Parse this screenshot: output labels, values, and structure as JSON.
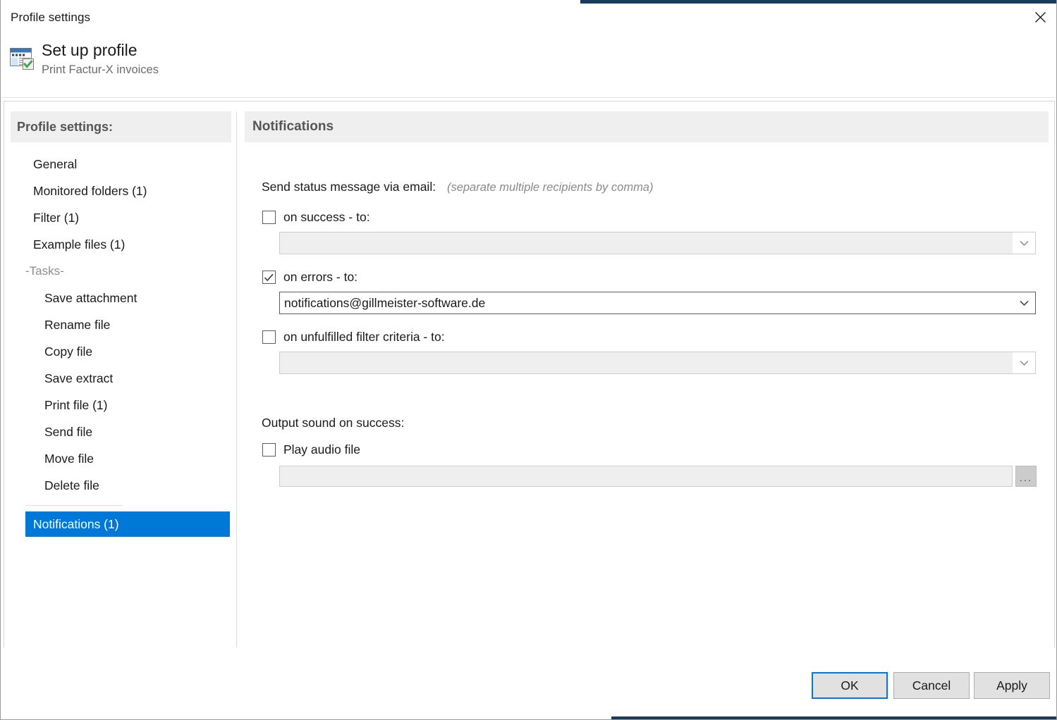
{
  "window": {
    "title": "Profile settings",
    "close_icon": "close-icon"
  },
  "header": {
    "icon": "profile-window-check-icon",
    "title": "Set up profile",
    "subtitle": "Print Factur-X invoices"
  },
  "sidebar": {
    "header": "Profile settings:",
    "items": [
      {
        "label": "General",
        "level": 1,
        "selected": false
      },
      {
        "label": "Monitored folders (1)",
        "level": 1,
        "selected": false
      },
      {
        "label": "Filter (1)",
        "level": 1,
        "selected": false
      },
      {
        "label": "Example files (1)",
        "level": 1,
        "selected": false
      },
      {
        "label": "-Tasks-",
        "level": 0,
        "selected": false,
        "group": true
      },
      {
        "label": "Save attachment",
        "level": 2,
        "selected": false
      },
      {
        "label": "Rename file",
        "level": 2,
        "selected": false
      },
      {
        "label": "Copy file",
        "level": 2,
        "selected": false
      },
      {
        "label": "Save extract",
        "level": 2,
        "selected": false
      },
      {
        "label": "Print file (1)",
        "level": 2,
        "selected": false
      },
      {
        "label": "Send file",
        "level": 2,
        "selected": false
      },
      {
        "label": "Move file",
        "level": 2,
        "selected": false
      },
      {
        "label": "Delete file",
        "level": 2,
        "selected": false
      },
      {
        "separator": true
      },
      {
        "label": "Notifications (1)",
        "level": 1,
        "selected": true
      }
    ]
  },
  "content": {
    "header": "Notifications",
    "email_section": {
      "label": "Send status message via email:",
      "hint": "(separate multiple recipients by comma)",
      "rows": [
        {
          "checkbox_label": "on success - to:",
          "checked": false,
          "value": "",
          "enabled": false,
          "dropdown_icon": "chevron-down-icon"
        },
        {
          "checkbox_label": "on errors - to:",
          "checked": true,
          "value": "notifications@gillmeister-software.de",
          "enabled": true,
          "dropdown_icon": "chevron-down-icon"
        },
        {
          "checkbox_label": "on unfulfilled filter criteria - to:",
          "checked": false,
          "value": "",
          "enabled": false,
          "dropdown_icon": "chevron-down-icon"
        }
      ]
    },
    "sound_section": {
      "label": "Output sound on success:",
      "checkbox_label": "Play audio file",
      "checked": false,
      "path_value": "",
      "browse_label": "...",
      "browse_icon": "ellipsis-icon"
    }
  },
  "footer": {
    "ok": "OK",
    "cancel": "Cancel",
    "apply": "Apply"
  },
  "colors": {
    "accent": "#0078d7",
    "panel_header_bg": "#efefef",
    "panel_header_text": "#555555",
    "title_strip": "#1b3a5c",
    "disabled_field_bg": "#efefef"
  }
}
